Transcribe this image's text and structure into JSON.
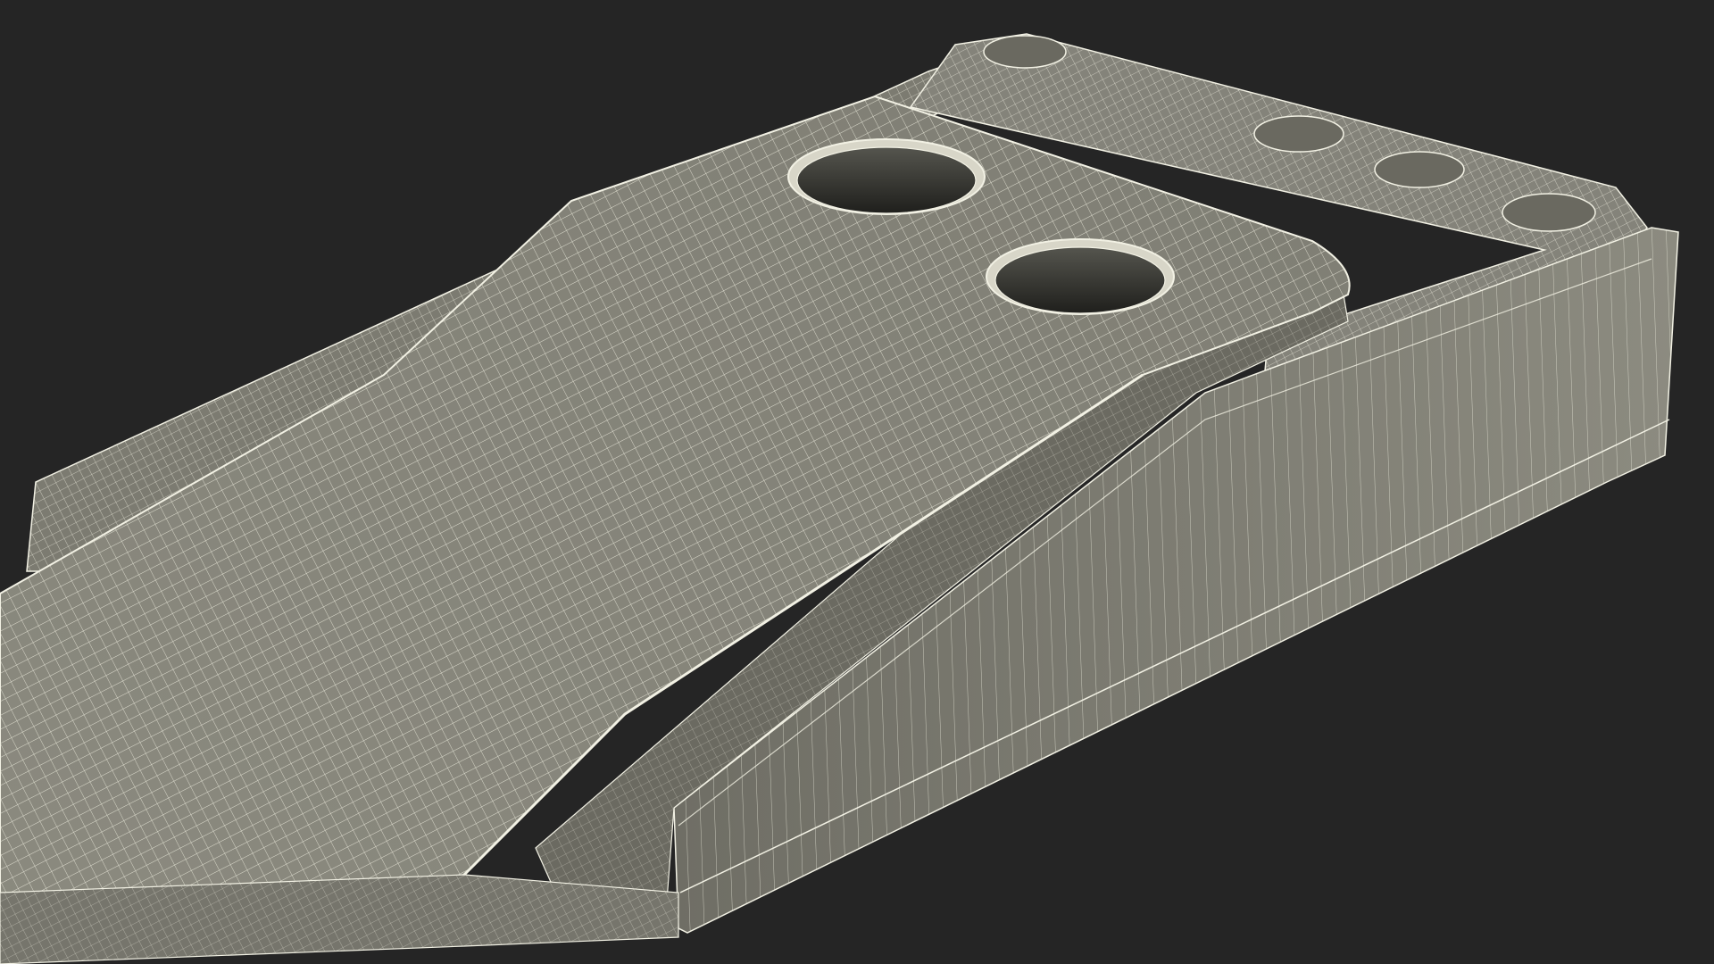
{
  "scene": {
    "subject": "wireframe-3d-model",
    "colors": {
      "background": "#252525",
      "surface_light": "#8f8e83",
      "surface_mid": "#7b7a70",
      "surface_dark": "#5f5e56",
      "hole_interior": "#2a2a26",
      "wire": "#f2f1e4"
    }
  }
}
